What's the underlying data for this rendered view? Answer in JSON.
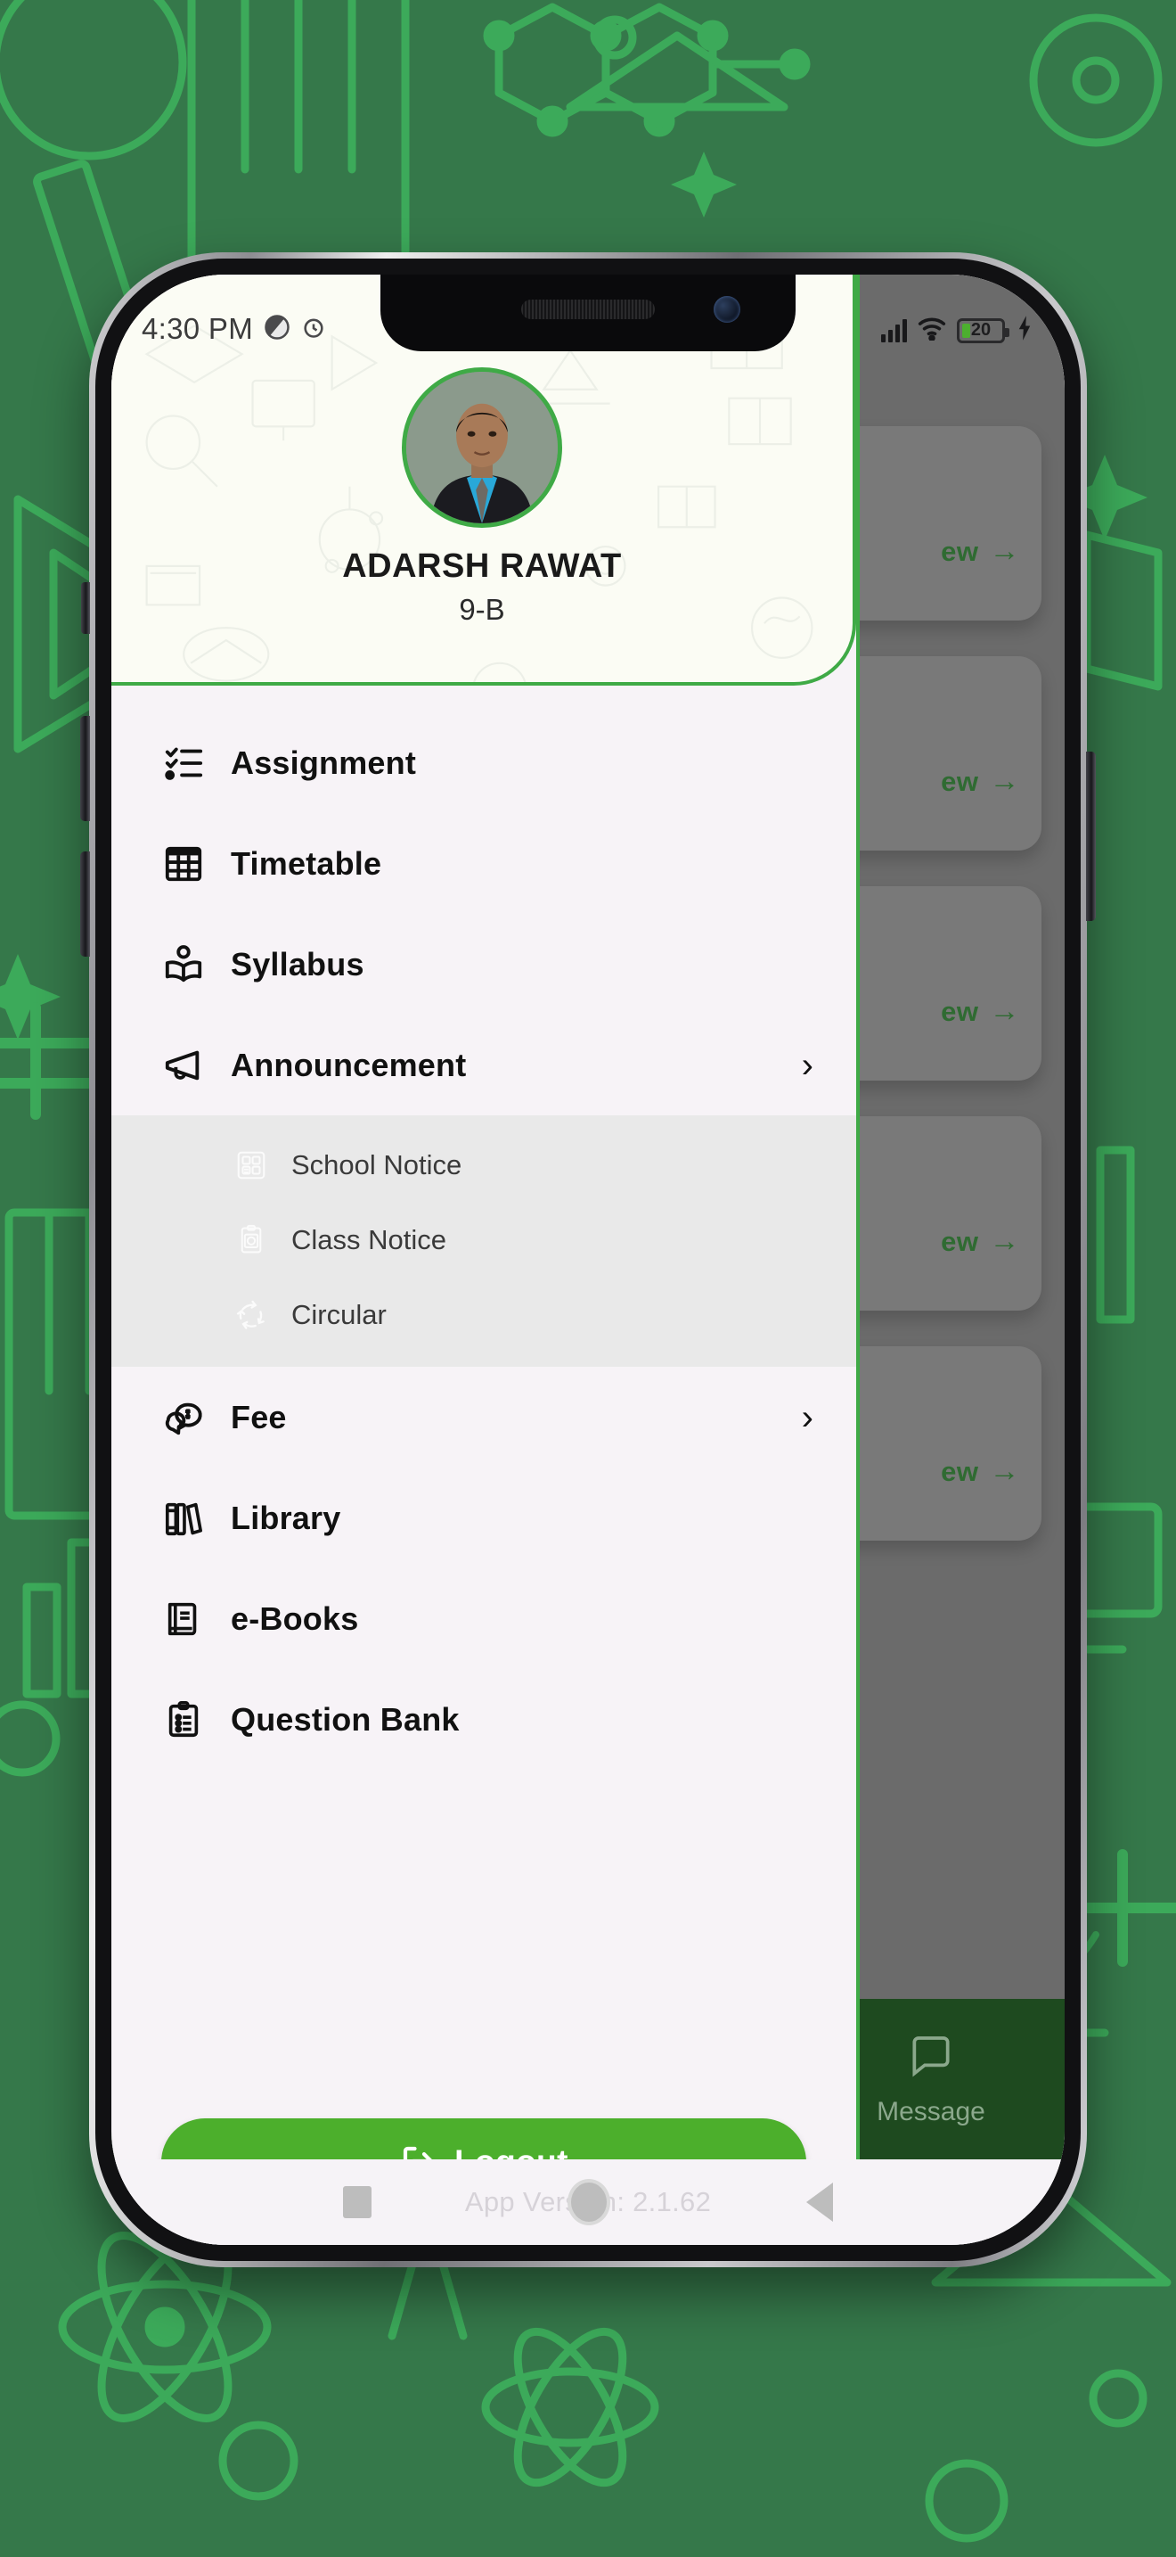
{
  "wallpaper": {
    "base_color": "#35784a",
    "doodle_color": "#3caa5a"
  },
  "theme": {
    "accent_green": "#3faa46",
    "logout_green": "#4caf2c",
    "drawer_bg": "#f7f3f7",
    "submenu_bg": "#e9e9e9",
    "profile_bg": "#fbfcf4",
    "bottomnav_green": "#1e4a1f"
  },
  "statusbar": {
    "time": "4:30 PM",
    "left_icons": [
      "dnd-circle-icon",
      "alarm-icon"
    ],
    "signal_icon": "cellular-signal-icon",
    "wifi_icon": "wifi-icon",
    "battery_percent": "20",
    "charging_icon": "charging-bolt-icon"
  },
  "profile": {
    "avatar_icon": "student-photo-avatar",
    "name": "ADARSH RAWAT",
    "class": "9-B"
  },
  "menu": {
    "items": [
      {
        "label": "Assignment",
        "icon": "checklist-icon",
        "has_chevron": false,
        "chevron": ""
      },
      {
        "label": "Timetable",
        "icon": "grid-table-icon",
        "has_chevron": false,
        "chevron": ""
      },
      {
        "label": "Syllabus",
        "icon": "open-book-person-icon",
        "has_chevron": false,
        "chevron": ""
      },
      {
        "label": "Announcement",
        "icon": "megaphone-icon",
        "has_chevron": true,
        "chevron": "›"
      }
    ],
    "submenu": [
      {
        "label": "School Notice",
        "icon": "notice-board-icon"
      },
      {
        "label": "Class Notice",
        "icon": "clipboard-notice-icon"
      },
      {
        "label": "Circular",
        "icon": "circular-refresh-icon"
      }
    ],
    "items_after": [
      {
        "label": "Fee",
        "icon": "money-chat-icon",
        "has_chevron": true,
        "chevron": "›"
      },
      {
        "label": "Library",
        "icon": "books-shelf-icon",
        "has_chevron": false,
        "chevron": ""
      },
      {
        "label": "e-Books",
        "icon": "ebook-icon",
        "has_chevron": false,
        "chevron": ""
      },
      {
        "label": "Question Bank",
        "icon": "clipboard-list-icon",
        "has_chevron": false,
        "chevron": ""
      }
    ]
  },
  "logout": {
    "label": "Logout",
    "icon": "logout-arrow-icon"
  },
  "footer": {
    "app_version": "App Version: 2.1.62"
  },
  "background_app": {
    "cards": [
      {
        "view_label": "ew",
        "arrow": "→"
      },
      {
        "view_label": "ew",
        "arrow": "→"
      },
      {
        "view_label": "ew",
        "arrow": "→"
      },
      {
        "view_label": "ew",
        "arrow": "→"
      },
      {
        "view_label": "ew",
        "arrow": "→"
      }
    ],
    "bottom_nav": {
      "label": "Message",
      "icon": "chat-bubble-icon"
    }
  },
  "android_nav": {
    "recents_icon": "square-recents-icon",
    "home_icon": "circle-home-icon",
    "back_icon": "triangle-back-icon"
  }
}
